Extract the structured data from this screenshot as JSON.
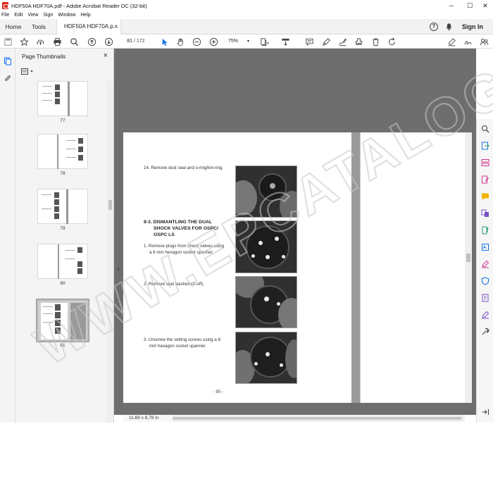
{
  "window": {
    "title": "HDF50A HDF70A.pdf - Adobe Acrobat Reader DC (32-bit)",
    "minimize": "─",
    "maximize": "☐",
    "close": "✕"
  },
  "menu": [
    "File",
    "Edit",
    "View",
    "Sign",
    "Window",
    "Help"
  ],
  "tabs": {
    "home": "Home",
    "tools": "Tools",
    "document": "HDF50A HDF70A.p...",
    "document_close": "×"
  },
  "header": {
    "help": "?",
    "signin": "Sign In"
  },
  "toolbar": {
    "page_current": "81",
    "page_total": "/ 172",
    "zoom": "75%",
    "zoom_caret": "▾"
  },
  "thumbnails": {
    "title": "Page Thumbnails",
    "close": "×",
    "pages": [
      {
        "label": "77"
      },
      {
        "label": "78"
      },
      {
        "label": "79"
      },
      {
        "label": "80"
      },
      {
        "label": "81"
      }
    ]
  },
  "document": {
    "step14": "14. Remove dust seal and o-ring/kin-ring.",
    "section_heading_line1": "8-3.  DISMANTLING THE DUAL",
    "section_heading_line2": "SHOCK VALVES FOR OSPC/",
    "section_heading_line3": "OSPC LS",
    "step1_line1": "1.  Remove plugs from shock valves using",
    "step1_line2": "a 6 mm hexagon socket spanner.",
    "step2": "2.  Remove seal washers(2-off).",
    "step3_line1": "3.  Unscrew the setting screws using a 6",
    "step3_line2": "mm hexagon socket spanner.",
    "page_number": "- 85 -"
  },
  "status": {
    "page_size": "11,69 x 8,78 in"
  },
  "watermark": {
    "text": "WWW.EPCATALOG.COM"
  },
  "colors": {
    "accent": "#d9261c",
    "doc_background": "#6e6e6e",
    "blue_tools": "#1473e6",
    "purple_tools": "#7a4fc7",
    "pink_tools": "#d1338c",
    "green_tools": "#2d9d78"
  }
}
